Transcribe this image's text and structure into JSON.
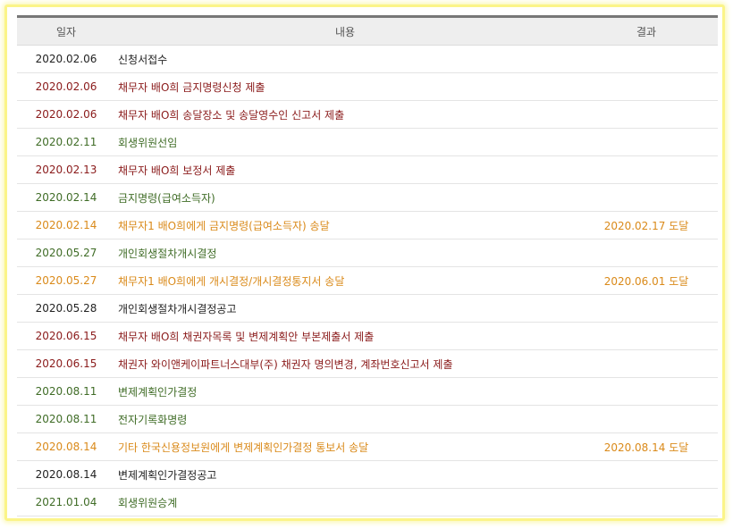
{
  "headers": {
    "date": "일자",
    "content": "내용",
    "result": "결과"
  },
  "colors": {
    "dark": "#222222",
    "red": "#8a1a1a",
    "green": "#3f6c26",
    "orange": "#da8a1a"
  },
  "rows": [
    {
      "date": "2020.02.06",
      "content": "신청서접수",
      "result": "",
      "color": "dark"
    },
    {
      "date": "2020.02.06",
      "content": "채무자 배O희 금지명령신청 제출",
      "result": "",
      "color": "red"
    },
    {
      "date": "2020.02.06",
      "content": "채무자 배O희 송달장소 및 송달영수인 신고서 제출",
      "result": "",
      "color": "red"
    },
    {
      "date": "2020.02.11",
      "content": "회생위원선임",
      "result": "",
      "color": "green"
    },
    {
      "date": "2020.02.13",
      "content": "채무자 배O희 보정서 제출",
      "result": "",
      "color": "red"
    },
    {
      "date": "2020.02.14",
      "content": "금지명령(급여소득자)",
      "result": "",
      "color": "green"
    },
    {
      "date": "2020.02.14",
      "content": "채무자1 배O희에게 금지명령(급여소득자) 송달",
      "result": "2020.02.17 도달",
      "color": "orange"
    },
    {
      "date": "2020.05.27",
      "content": "개인회생절차개시결정",
      "result": "",
      "color": "green"
    },
    {
      "date": "2020.05.27",
      "content": "채무자1 배O희에게 개시결정/개시결정통지서 송달",
      "result": "2020.06.01 도달",
      "color": "orange"
    },
    {
      "date": "2020.05.28",
      "content": "개인회생절차개시결정공고",
      "result": "",
      "color": "dark"
    },
    {
      "date": "2020.06.15",
      "content": "채무자 배O희 채권자목록 및 변제계획안 부본제출서 제출",
      "result": "",
      "color": "red"
    },
    {
      "date": "2020.06.15",
      "content": "채권자 와이앤케이파트너스대부(주) 채권자 명의변경, 계좌번호신고서 제출",
      "result": "",
      "color": "red"
    },
    {
      "date": "2020.08.11",
      "content": "변제계획인가결정",
      "result": "",
      "color": "green"
    },
    {
      "date": "2020.08.11",
      "content": "전자기록화명령",
      "result": "",
      "color": "green"
    },
    {
      "date": "2020.08.14",
      "content": "기타 한국신용정보원에게 변제계획인가결정 통보서 송달",
      "result": "2020.08.14 도달",
      "color": "orange"
    },
    {
      "date": "2020.08.14",
      "content": "변제계획인가결정공고",
      "result": "",
      "color": "dark"
    },
    {
      "date": "2021.01.04",
      "content": "회생위원승계",
      "result": "",
      "color": "green"
    }
  ]
}
